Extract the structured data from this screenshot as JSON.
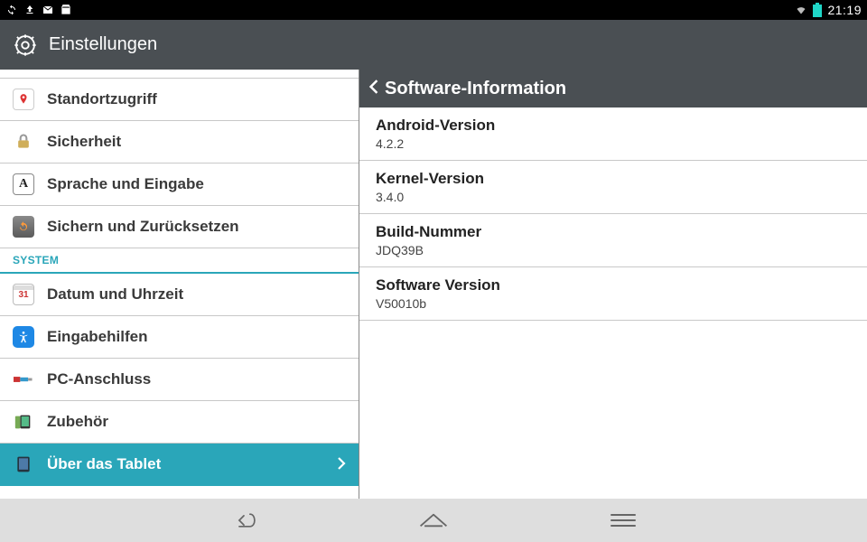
{
  "status": {
    "time": "21:19"
  },
  "header": {
    "title": "Einstellungen"
  },
  "sidebar": {
    "items": [
      {
        "label": "Standortzugriff"
      },
      {
        "label": "Sicherheit"
      },
      {
        "label": "Sprache und Eingabe"
      },
      {
        "label": "Sichern und Zurücksetzen"
      }
    ],
    "category": "SYSTEM",
    "system_items": [
      {
        "label": "Datum und Uhrzeit"
      },
      {
        "label": "Eingabehilfen"
      },
      {
        "label": "PC-Anschluss"
      },
      {
        "label": "Zubehör"
      },
      {
        "label": "Über das Tablet"
      }
    ]
  },
  "detail": {
    "title": "Software-Information",
    "rows": [
      {
        "k": "Android-Version",
        "v": "4.2.2"
      },
      {
        "k": "Kernel-Version",
        "v": "3.4.0"
      },
      {
        "k": "Build-Nummer",
        "v": "JDQ39B"
      },
      {
        "k": "Software Version",
        "v": "V50010b"
      }
    ]
  }
}
